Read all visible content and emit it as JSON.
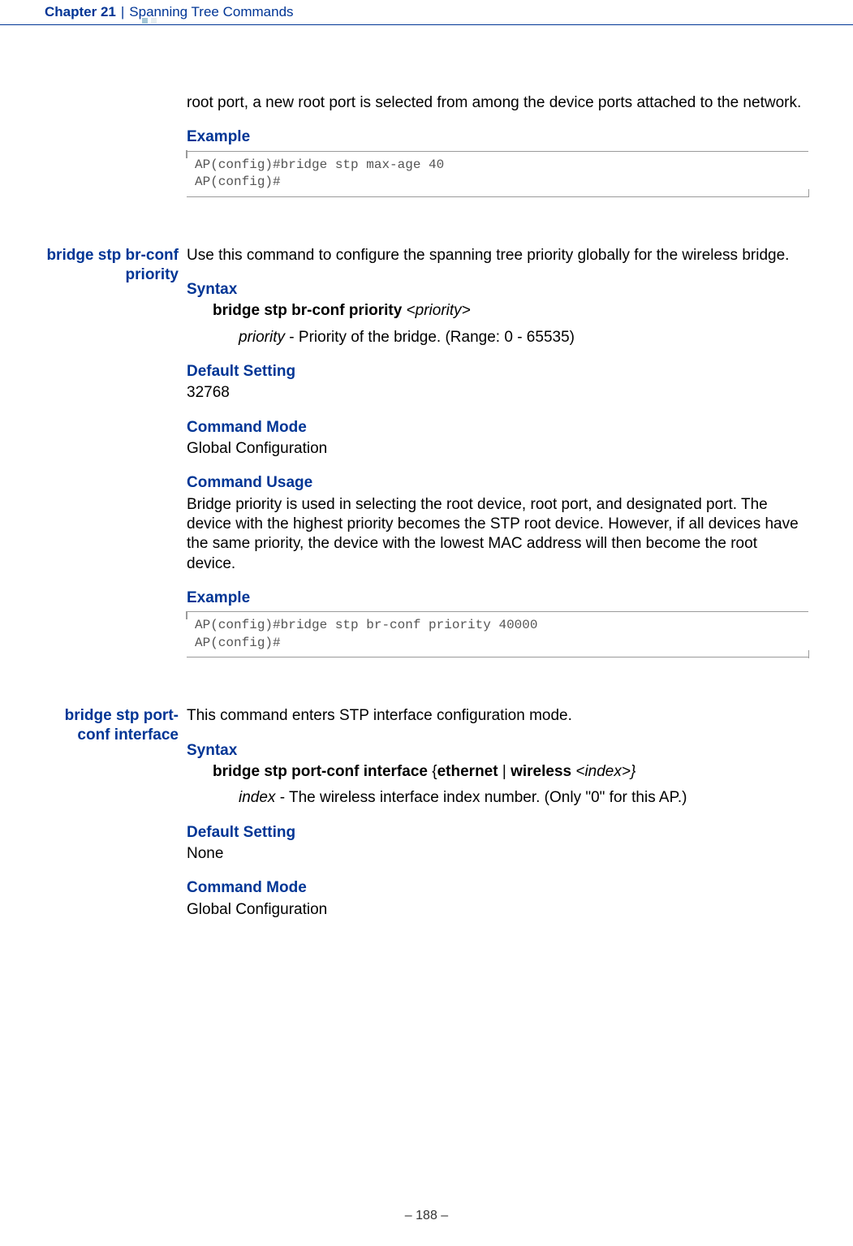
{
  "header": {
    "chapter_num": "Chapter 21",
    "separator": "|",
    "chapter_title": "Spanning Tree Commands"
  },
  "intro_continuation": "root port, a new root port is selected from among the device ports attached to the network.",
  "section1": {
    "example_h": "Example",
    "code": "AP(config)#bridge stp max-age 40\nAP(config)#"
  },
  "section2": {
    "sidebar": "bridge stp br-conf priority",
    "desc": "Use this command to configure the spanning tree priority globally for the wireless bridge.",
    "syntax_h": "Syntax",
    "syntax_cmd_bold": "bridge stp br-conf priority",
    "syntax_cmd_arg": " <priority>",
    "syntax_param_name": "priority",
    "syntax_param_desc": " - Priority of the bridge. (Range: 0 - 65535)",
    "default_h": "Default Setting",
    "default_v": "32768",
    "mode_h": "Command Mode",
    "mode_v": "Global Configuration",
    "usage_h": "Command Usage",
    "usage_v": "Bridge priority is used in selecting the root device, root port, and designated port. The device with the highest priority becomes the STP root device. However, if all devices have the same priority, the device with the lowest MAC address will then become the root device.",
    "example_h": "Example",
    "code": "AP(config)#bridge stp br-conf priority 40000\nAP(config)#"
  },
  "section3": {
    "sidebar": "bridge stp port-conf interface",
    "desc": "This command enters STP interface configuration mode.",
    "syntax_h": "Syntax",
    "syntax_cmd_part1": "bridge stp port-conf interface ",
    "syntax_cmd_brace1": "{",
    "syntax_cmd_eth": "ethernet",
    "syntax_cmd_pipe": " | ",
    "syntax_cmd_wl": "wireless",
    "syntax_cmd_arg": " <index>}",
    "syntax_param_name": "index",
    "syntax_param_desc": " - The wireless interface index number. (Only \"0\" for this AP.)",
    "default_h": "Default Setting",
    "default_v": "None",
    "mode_h": "Command Mode",
    "mode_v": "Global Configuration"
  },
  "footer": "–  188  –"
}
